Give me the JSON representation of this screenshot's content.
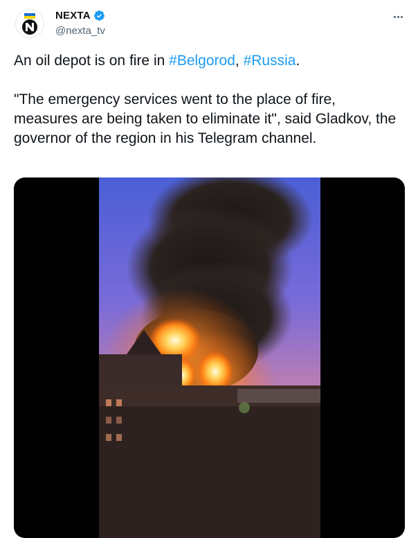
{
  "author": {
    "display_name": "NEXTA",
    "handle": "@nexta_tv",
    "avatar_icon": "nexta-logo-icon",
    "verified_icon": "verified-badge-icon",
    "verified_color": "#1d9bf0"
  },
  "menu": {
    "more_icon": "more-options-icon"
  },
  "tweet": {
    "line1_text": "An oil depot is on fire in ",
    "hashtag1": "#Belgorod",
    "separator": ", ",
    "hashtag2": "#Russia",
    "line1_end": ".",
    "quote": "\"The emergency services went to the place of fire, measures are being taken to eliminate it\", said Gladkov, the governor of the region in his Telegram channel."
  },
  "media": {
    "type": "video",
    "description_icon": "video-thumbnail-fire"
  },
  "colors": {
    "text": "#0f1419",
    "secondary": "#536471",
    "link": "#1d9bf0"
  }
}
